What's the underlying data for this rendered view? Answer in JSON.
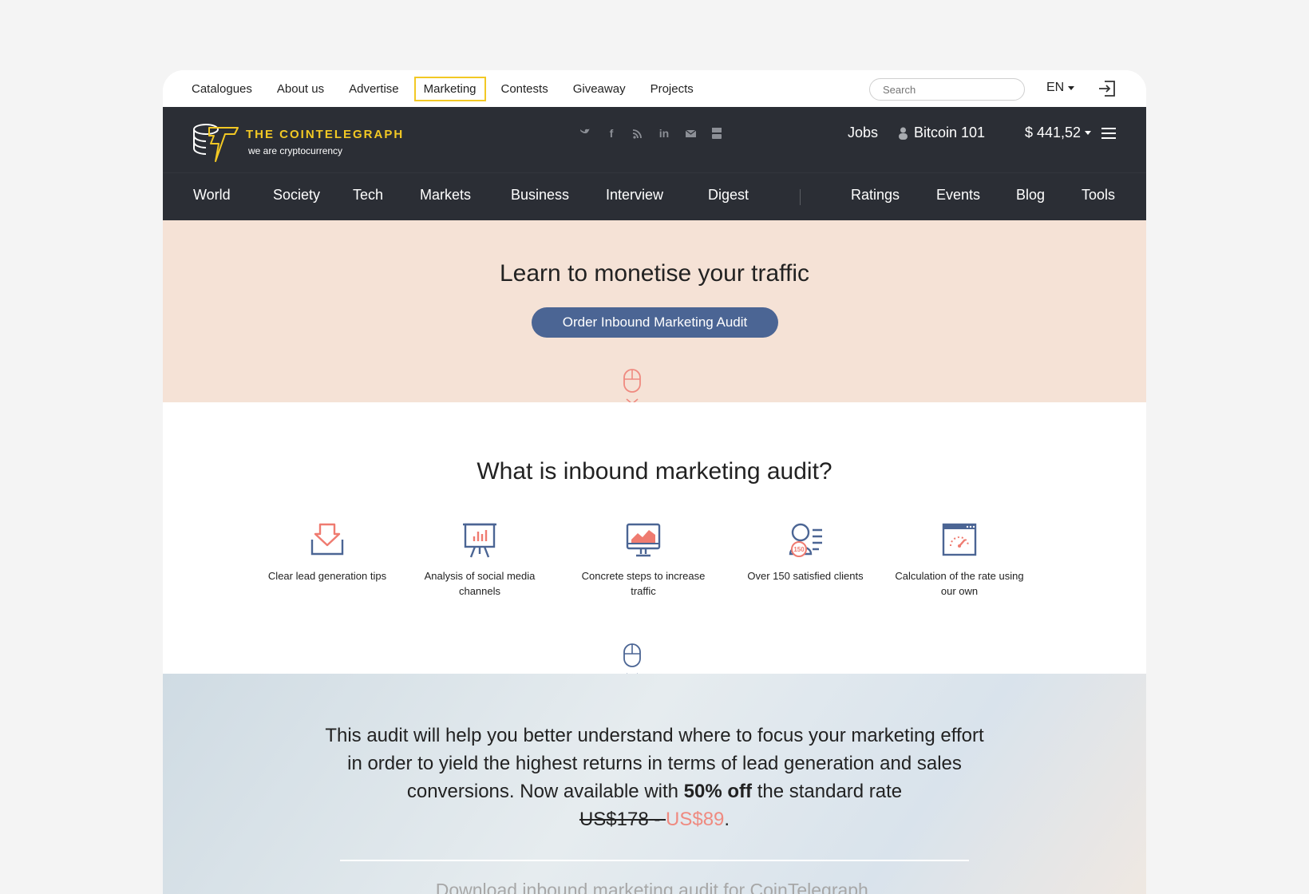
{
  "topbar": {
    "links": [
      "Catalogues",
      "About us",
      "Advertise",
      "Marketing",
      "Contests",
      "Giveaway",
      "Projects"
    ],
    "active": "Marketing",
    "search_placeholder": "Search",
    "language": "EN"
  },
  "header": {
    "brand": "THE COINTELEGRAPH",
    "tagline": "we are cryptocurrency",
    "social_icons": [
      "twitter-icon",
      "facebook-icon",
      "rss-icon",
      "linkedin-icon",
      "mail-icon",
      "youtube-icon"
    ],
    "jobs": "Jobs",
    "bitcoin101": "Bitcoin 101",
    "price": "$ 441,52"
  },
  "mainnav": {
    "left": [
      "World",
      "Society",
      "Tech",
      "Markets",
      "Business",
      "Interview",
      "Digest"
    ],
    "right": [
      "Ratings",
      "Events",
      "Blog",
      "Tools"
    ]
  },
  "hero": {
    "title": "Learn to monetise your traffic",
    "cta": "Order Inbound Marketing Audit"
  },
  "what": {
    "title": "What is inbound marketing audit?",
    "features": [
      {
        "icon": "lead-tray-icon",
        "text": "Clear lead generation tips"
      },
      {
        "icon": "presentation-chart-icon",
        "text": "Analysis of social media channels"
      },
      {
        "icon": "monitor-graph-icon",
        "text": "Concrete steps to increase traffic"
      },
      {
        "icon": "clients-150-icon",
        "text": "Over 150 satisfied clients"
      },
      {
        "icon": "speedometer-window-icon",
        "text": "Calculation of the rate using our own"
      }
    ]
  },
  "bottom": {
    "lead_part1": "This audit will help you better understand where to focus your marketing effort in order to yield the highest returns in terms of lead generation and sales conversions.  Now available with ",
    "discount": "50% off",
    "lead_part2": " the standard rate",
    "old_price": "US$178",
    "dash": " - ",
    "new_price": "US$89",
    "period": ".",
    "download": "Download inbound marketing audit for CoinTelegraph."
  },
  "colors": {
    "accent_yellow": "#f2c824",
    "header_dark": "#2b2e35",
    "button_blue": "#4b6594",
    "hero_peach": "#f5e2d6",
    "price_red": "#ef8a80"
  }
}
